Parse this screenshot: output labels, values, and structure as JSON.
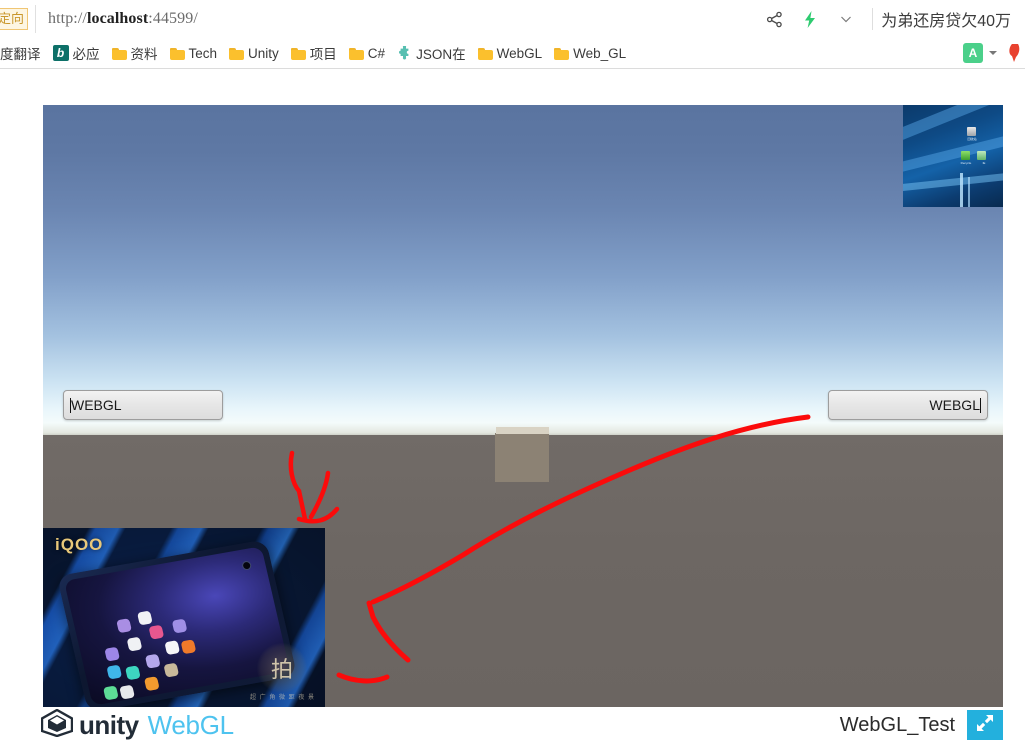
{
  "browser": {
    "addressbar": {
      "redirect_badge": "定向",
      "url_scheme": "http://",
      "url_host": "localhost",
      "url_rest": ":44599/",
      "url_full": "http://localhost:44599/",
      "share_icon": "share-icon",
      "lightning_icon": "lightning-bolt-icon",
      "chevron_icon": "chevron-down-icon",
      "promo_text": "为弟还房贷欠40万"
    },
    "bookmarks": {
      "items": [
        {
          "label": "度翻译",
          "icon": "translate-partial-icon"
        },
        {
          "label": "必应",
          "icon": "bing-icon"
        },
        {
          "label": "资料",
          "icon": "folder-icon"
        },
        {
          "label": "Tech",
          "icon": "folder-icon"
        },
        {
          "label": "Unity",
          "icon": "folder-icon"
        },
        {
          "label": "项目",
          "icon": "folder-icon"
        },
        {
          "label": "C#",
          "icon": "folder-icon"
        },
        {
          "label": "JSON在",
          "icon": "puzzle-icon"
        },
        {
          "label": "WebGL",
          "icon": "folder-icon"
        },
        {
          "label": "Web_GL",
          "icon": "folder-icon"
        }
      ],
      "bing_glyph": "b",
      "translate_ext_glyph": "A",
      "translate_ext_icon": "translate-extension-icon",
      "caret_icon": "chevron-down-icon",
      "pin_icon": "bookmark-pin-icon"
    }
  },
  "unity": {
    "canvas": {
      "left_input": {
        "value": "WEBGL",
        "placeholder": "WEBGL"
      },
      "right_input": {
        "value": "WEBGL",
        "placeholder": "WEBGL"
      },
      "cube_name": "scene-cube",
      "desktop_thumbnail": {
        "name": "windows-desktop-screenshot",
        "icons": [
          {
            "label": "回收站"
          },
          {
            "label": "Recycle"
          },
          {
            "label": "IE"
          }
        ]
      },
      "phone_ad": {
        "name": "iqoo-phone-advertisement",
        "brand": "iQOO",
        "seal_char": "拍",
        "seal_sub": "超 广 角 微 距 夜 景"
      },
      "annotations": [
        {
          "name": "red-arrow-to-phone-image"
        },
        {
          "name": "red-arrow-from-right-input"
        }
      ],
      "annotation_color": "#fb0b0b"
    },
    "footer": {
      "logo_text": "unity",
      "logo_suffix": "WebGL",
      "build_title": "WebGL_Test",
      "fullscreen_icon": "fullscreen-expand-icon",
      "fullscreen_color": "#23b0dd"
    }
  },
  "colors": {
    "unity_cyan": "#4ec3ef",
    "unity_dark": "#222c37",
    "annotation_red": "#fb0b0b",
    "sky_top": "#5a74a0",
    "ground": "#6e6865",
    "bing_teal": "#0d7068",
    "folder_yellow": "#fbc02d"
  }
}
